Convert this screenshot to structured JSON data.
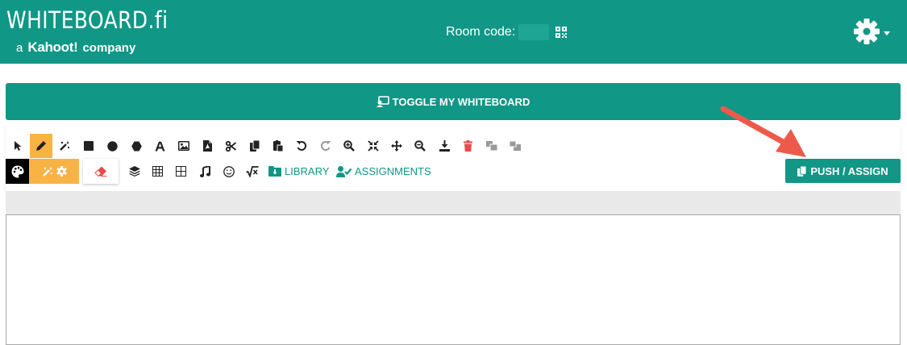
{
  "header": {
    "logo_text": "WHITEBOARD.fi",
    "logo_sub_a": "a",
    "logo_sub_brand": "Kahoot!",
    "logo_sub_company": "company",
    "room_code_label": "Room code:",
    "settings_icon": "gear-icon"
  },
  "toggle": {
    "label": "TOGGLE MY WHITEBOARD",
    "icon": "whiteboard-user-icon"
  },
  "toolbar": {
    "row1_tools": [
      {
        "name": "select",
        "icon": "pointer-icon",
        "active": false
      },
      {
        "name": "pen",
        "icon": "pen-icon",
        "active": true
      },
      {
        "name": "magic-pen",
        "icon": "magic-wand-icon",
        "active": false
      },
      {
        "name": "rectangle",
        "icon": "square-icon",
        "active": false
      },
      {
        "name": "circle",
        "icon": "circle-icon",
        "active": false
      },
      {
        "name": "polygon",
        "icon": "hexagon-icon",
        "active": false
      },
      {
        "name": "text",
        "icon": "text-icon",
        "active": false
      },
      {
        "name": "image",
        "icon": "image-icon",
        "active": false
      },
      {
        "name": "pdf",
        "icon": "file-pdf-icon",
        "active": false
      },
      {
        "name": "cut",
        "icon": "scissors-icon",
        "active": false
      },
      {
        "name": "copy",
        "icon": "copy-icon",
        "active": false
      },
      {
        "name": "paste",
        "icon": "paste-icon",
        "active": false
      },
      {
        "name": "undo",
        "icon": "undo-icon",
        "active": false
      },
      {
        "name": "redo",
        "icon": "redo-icon",
        "active": false
      },
      {
        "name": "zoom-in",
        "icon": "zoom-in-icon",
        "active": false
      },
      {
        "name": "fit",
        "icon": "compress-icon",
        "active": false
      },
      {
        "name": "move",
        "icon": "arrows-move-icon",
        "active": false
      },
      {
        "name": "zoom-out",
        "icon": "zoom-out-icon",
        "active": false
      },
      {
        "name": "download",
        "icon": "download-icon",
        "active": false
      },
      {
        "name": "delete",
        "icon": "trash-icon",
        "active": false
      },
      {
        "name": "bring-forward",
        "icon": "bring-forward-icon",
        "active": false
      },
      {
        "name": "send-backward",
        "icon": "send-backward-icon",
        "active": false
      }
    ],
    "library_label": "LIBRARY",
    "assignments_label": "ASSIGNMENTS",
    "push_assign_label": "PUSH / ASSIGN"
  },
  "colors": {
    "primary": "#109786",
    "accent": "#f9b344",
    "danger": "#e84c4c",
    "arrow": "#ee5a4a"
  }
}
